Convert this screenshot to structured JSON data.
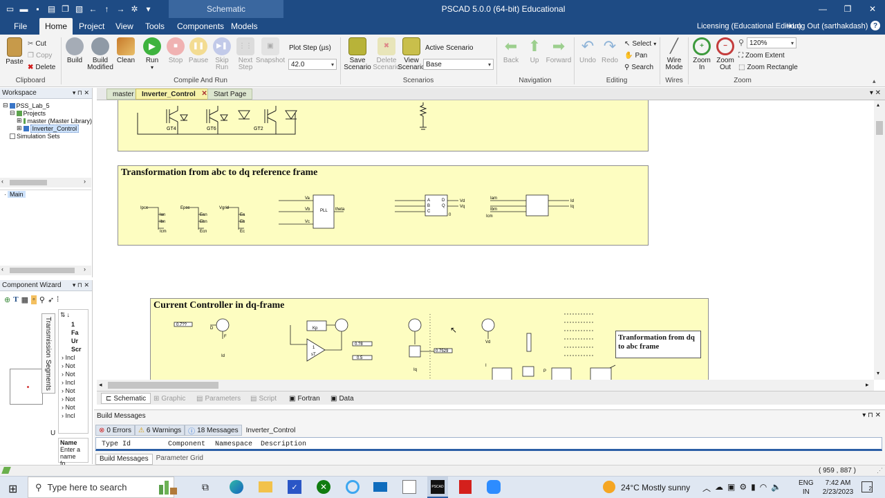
{
  "window": {
    "document_tab": "Schematic",
    "app_title": "PSCAD 5.0.0 (64-bit) Educational"
  },
  "menu": {
    "items": [
      "File",
      "Home",
      "Project",
      "View",
      "Tools",
      "Components",
      "Models"
    ],
    "active": "Home",
    "licensing": "Licensing (Educational Edition)",
    "logout": "Log Out (sarthakdash)",
    "help": "?"
  },
  "ribbon": {
    "clipboard": {
      "paste": "Paste",
      "cut": "Cut",
      "copy": "Copy",
      "delete": "Delete",
      "label": "Clipboard"
    },
    "compile": {
      "build": "Build",
      "build_modified": "Build Modified",
      "clean": "Clean",
      "run": "Run",
      "stop": "Stop",
      "pause": "Pause",
      "skip_run": "Skip Run",
      "next_step": "Next Step",
      "snapshot": "Snapshot",
      "plot_step_label": "Plot Step (µs)",
      "plot_step_value": "42.0",
      "label": "Compile And Run"
    },
    "scenarios": {
      "save": "Save Scenario",
      "delete": "Delete Scenario",
      "view": "View Scenario",
      "active_label": "Active Scenario",
      "active_value": "Base",
      "label": "Scenarios"
    },
    "navigation": {
      "back": "Back",
      "up": "Up",
      "forward": "Forward",
      "label": "Navigation"
    },
    "editing": {
      "undo": "Undo",
      "redo": "Redo",
      "select": "Select",
      "pan": "Pan",
      "search": "Search",
      "label": "Editing"
    },
    "wires": {
      "wire_mode": "Wire Mode",
      "label": "Wires"
    },
    "zoom": {
      "zoom_in": "Zoom In",
      "zoom_out": "Zoom Out",
      "zoom_value": "120%",
      "zoom_extent": "Zoom Extent",
      "zoom_rectangle": "Zoom Rectangle",
      "label": "Zoom"
    }
  },
  "workspace": {
    "title": "Workspace",
    "tree": [
      "PSS_Lab_5",
      "Projects",
      "master (Master Library)",
      "Inverter_Control",
      "Simulation Sets"
    ],
    "main_item": "Main"
  },
  "component_wizard": {
    "title": "Component Wizard",
    "vertical_tab": "Transmission Segments",
    "list_header": [
      "1",
      "Fa",
      "Ur",
      "Scr"
    ],
    "list_items": [
      "Incl",
      "Not",
      "Not",
      "Incl",
      "Not",
      "Not",
      "Not",
      "Incl",
      "Not"
    ],
    "name_label": "Name",
    "name_hint": "Enter a name fo...",
    "side_letter": "U"
  },
  "doc_tabs": [
    "master",
    "Inverter_Control",
    "Start Page"
  ],
  "canvas": {
    "module_titles": [
      "Transformation from abc to dq reference frame",
      "Current Controller in dq-frame"
    ],
    "callout": "Tranformation from dq to abc frame",
    "gate_labels": [
      "GT4",
      "GT6",
      "GT2"
    ],
    "meas_labels": [
      "Ipcc",
      "Ian",
      "Ibn",
      "Icm",
      "Epcc",
      "Ean",
      "Ebn",
      "Ecn",
      "Vgrid",
      "Ea",
      "Eb",
      "Ec",
      "PLL",
      "Va",
      "Vb",
      "Vc",
      "theta",
      "A",
      "B",
      "C",
      "D",
      "Q",
      "0",
      "Vd",
      "Vq",
      "Iam",
      "Ibm",
      "Icm",
      "Id",
      "Iq"
    ],
    "const_values": [
      "0.7??",
      "0.?8",
      "0.5",
      "0.7529"
    ],
    "controller_labels": [
      "D",
      "F",
      "Id",
      "Kp",
      "1",
      "sT",
      "Iq",
      "Vd",
      "I",
      "P"
    ]
  },
  "bottom_tabs": [
    "Schematic",
    "Graphic",
    "Parameters",
    "Script",
    "Fortran",
    "Data"
  ],
  "build_messages": {
    "title": "Build Messages",
    "errors": "0 Errors",
    "warnings": "6 Warnings",
    "messages": "18 Messages",
    "project": "Inverter_Control",
    "columns": [
      "Type",
      "Id",
      "Component",
      "Namespace",
      "Description"
    ],
    "tabs": [
      "Build Messages",
      "Parameter Grid"
    ]
  },
  "status": {
    "coords": "( 959 , 887 )"
  },
  "taskbar": {
    "search": "Type here to search",
    "weather": "24°C  Mostly sunny",
    "lang1": "ENG",
    "lang2": "IN",
    "time": "7:42 AM",
    "date": "2/23/2023",
    "notif": "2",
    "app_badge": "PSCAD"
  }
}
